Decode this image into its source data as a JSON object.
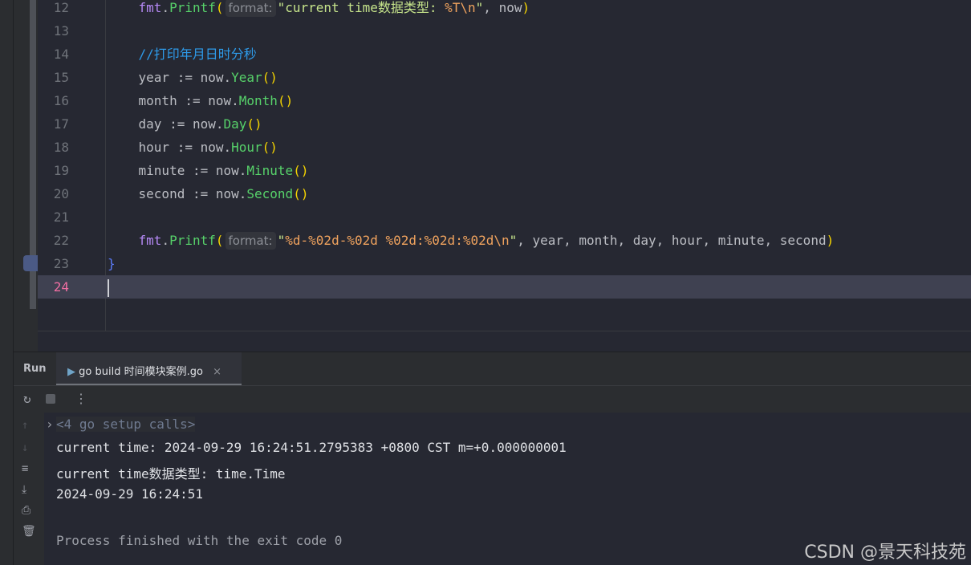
{
  "editor": {
    "current_line": 24,
    "lines": [
      {
        "n": 12,
        "tokens": [
          [
            "id",
            "    "
          ],
          [
            "pkg",
            "fmt"
          ],
          [
            "id",
            "."
          ],
          [
            "fn",
            "Printf"
          ],
          [
            "par",
            "("
          ],
          [
            "hint",
            "format:"
          ],
          [
            "str",
            "\"current time数据类型: "
          ],
          [
            "esc",
            "%T\\n"
          ],
          [
            "str",
            "\""
          ],
          [
            "id",
            ", now"
          ],
          [
            "par",
            ")"
          ]
        ]
      },
      {
        "n": 13,
        "tokens": []
      },
      {
        "n": 14,
        "tokens": [
          [
            "id",
            "    "
          ],
          [
            "cm",
            "//打印年月日时分秒"
          ]
        ]
      },
      {
        "n": 15,
        "tokens": [
          [
            "id",
            "    year := now."
          ],
          [
            "fn",
            "Year"
          ],
          [
            "par",
            "()"
          ]
        ]
      },
      {
        "n": 16,
        "tokens": [
          [
            "id",
            "    month := now."
          ],
          [
            "fn",
            "Month"
          ],
          [
            "par",
            "()"
          ]
        ]
      },
      {
        "n": 17,
        "tokens": [
          [
            "id",
            "    day := now."
          ],
          [
            "fn",
            "Day"
          ],
          [
            "par",
            "()"
          ]
        ]
      },
      {
        "n": 18,
        "tokens": [
          [
            "id",
            "    hour := now."
          ],
          [
            "fn",
            "Hour"
          ],
          [
            "par",
            "()"
          ]
        ]
      },
      {
        "n": 19,
        "tokens": [
          [
            "id",
            "    minute := now."
          ],
          [
            "fn",
            "Minute"
          ],
          [
            "par",
            "()"
          ]
        ]
      },
      {
        "n": 20,
        "tokens": [
          [
            "id",
            "    second := now."
          ],
          [
            "fn",
            "Second"
          ],
          [
            "par",
            "()"
          ]
        ]
      },
      {
        "n": 21,
        "tokens": []
      },
      {
        "n": 22,
        "tokens": [
          [
            "id",
            "    "
          ],
          [
            "pkg",
            "fmt"
          ],
          [
            "id",
            "."
          ],
          [
            "fn",
            "Printf"
          ],
          [
            "par",
            "("
          ],
          [
            "hint",
            "format:"
          ],
          [
            "str",
            "\""
          ],
          [
            "esc",
            "%d-%02d-%02d %02d:%02d:%02d\\n"
          ],
          [
            "str",
            "\""
          ],
          [
            "id",
            ", year, month, day, hour, minute, second"
          ],
          [
            "par",
            ")"
          ]
        ]
      },
      {
        "n": 23,
        "tokens": [
          [
            "br",
            "}"
          ]
        ]
      },
      {
        "n": 24,
        "tokens": []
      }
    ]
  },
  "run": {
    "label": "Run",
    "tab_label": "go build 时间模块案例.go",
    "tab_close": "×",
    "setup": "<4 go setup calls>",
    "output": [
      "current time: 2024-09-29 16:24:51.2795383 +0800 CST m=+0.000000001",
      "current time数据类型: time.Time",
      "2024-09-29 16:24:51",
      "",
      "Process finished with the exit code 0"
    ]
  },
  "watermark": "CSDN @景天科技苑"
}
